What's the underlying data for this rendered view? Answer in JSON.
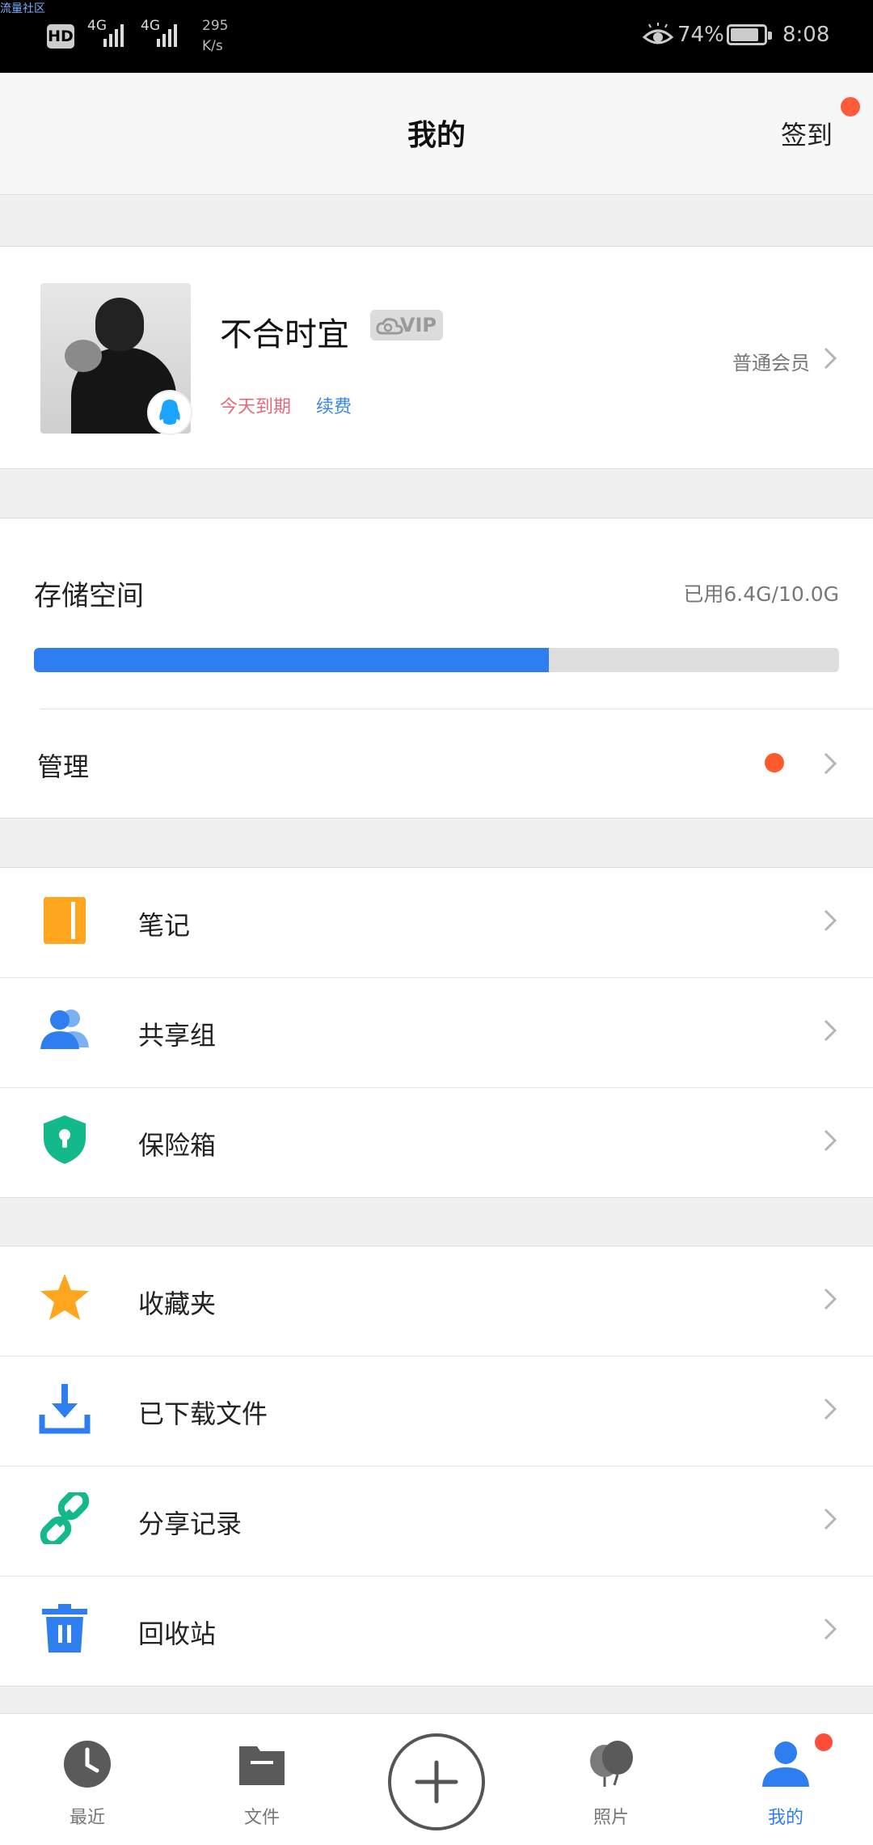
{
  "status_bar": {
    "watermark": "流量社区",
    "hd_label": "HD",
    "net1": "4G",
    "net2": "4G",
    "speed_value": "295",
    "speed_unit": "K/s",
    "battery_percent": "74%",
    "time": "8:08"
  },
  "header": {
    "title": "我的",
    "checkin_label": "签到"
  },
  "profile": {
    "username": "不合时宜",
    "vip_label": "VIP",
    "expire_text": "今天到期",
    "renew_label": "续费",
    "member_level": "普通会员"
  },
  "storage": {
    "label": "存储空间",
    "used_text": "已用6.4G/10.0G",
    "used_fraction": 0.64,
    "manage_label": "管理"
  },
  "menu_group_1": [
    {
      "label": "笔记",
      "icon": "notebook-icon",
      "color": "#ffa51e"
    },
    {
      "label": "共享组",
      "icon": "group-users-icon",
      "color": "#2f7ef0"
    },
    {
      "label": "保险箱",
      "icon": "safe-shield-icon",
      "color": "#13b98a"
    }
  ],
  "menu_group_2": [
    {
      "label": "收藏夹",
      "icon": "star-icon",
      "color": "#ffa51e"
    },
    {
      "label": "已下载文件",
      "icon": "download-icon",
      "color": "#2f7ef0"
    },
    {
      "label": "分享记录",
      "icon": "link-icon",
      "color": "#13b98a"
    },
    {
      "label": "回收站",
      "icon": "trash-icon",
      "color": "#2f7ef0"
    }
  ],
  "tab_bar": {
    "tabs": [
      {
        "label": "最近",
        "icon": "clock-icon"
      },
      {
        "label": "文件",
        "icon": "folder-icon"
      },
      {
        "label": "照片",
        "icon": "photo-balloon-icon"
      },
      {
        "label": "我的",
        "icon": "person-icon"
      }
    ],
    "accent": "#2f7ef0"
  }
}
